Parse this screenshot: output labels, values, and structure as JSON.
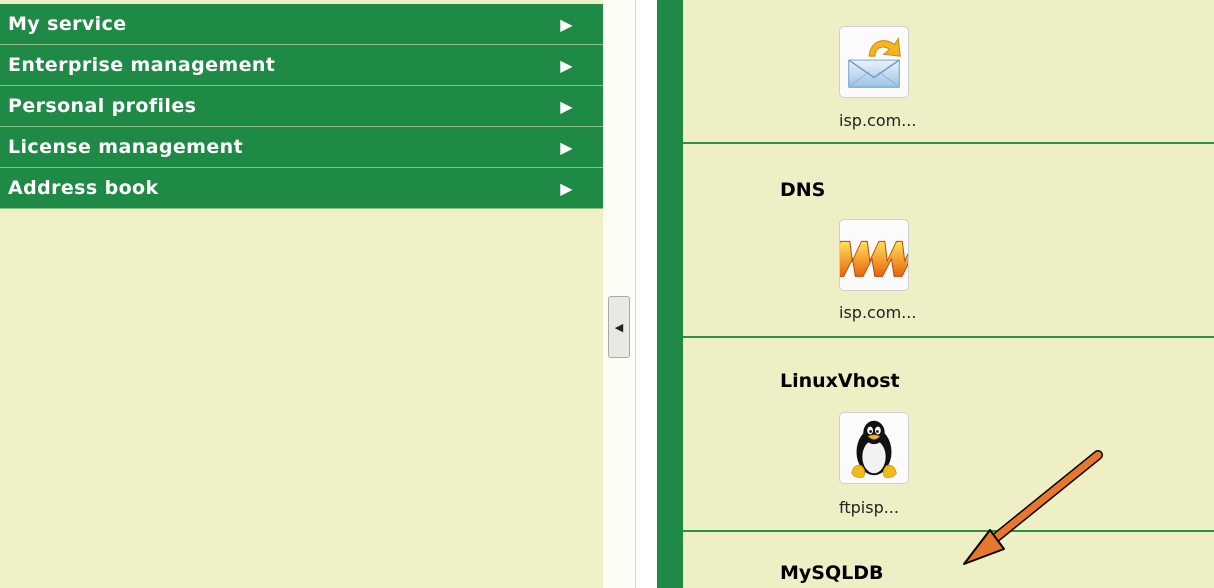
{
  "sidebar": {
    "items": [
      {
        "label": "My service",
        "arrow": "▶"
      },
      {
        "label": "Enterprise management",
        "arrow": "▶"
      },
      {
        "label": "Personal profiles",
        "arrow": "▶"
      },
      {
        "label": "License management",
        "arrow": "▶"
      },
      {
        "label": "Address book",
        "arrow": "▶"
      }
    ]
  },
  "collapse_toggle": {
    "glyph": "◀"
  },
  "services": [
    {
      "title": "",
      "icon": "mail-icon",
      "label": "isp.com..."
    },
    {
      "title": "DNS",
      "icon": "www-icon",
      "label": "isp.com..."
    },
    {
      "title": "LinuxVhost",
      "icon": "linux-tux-icon",
      "label": "ftpisp..."
    },
    {
      "title": "MySQLDB"
    }
  ],
  "colors": {
    "nav_green": "#1e8a46",
    "sidebar_bg": "#eff0c4",
    "content_bg": "#efefc6",
    "annotation_arrow": "#e8762b"
  }
}
